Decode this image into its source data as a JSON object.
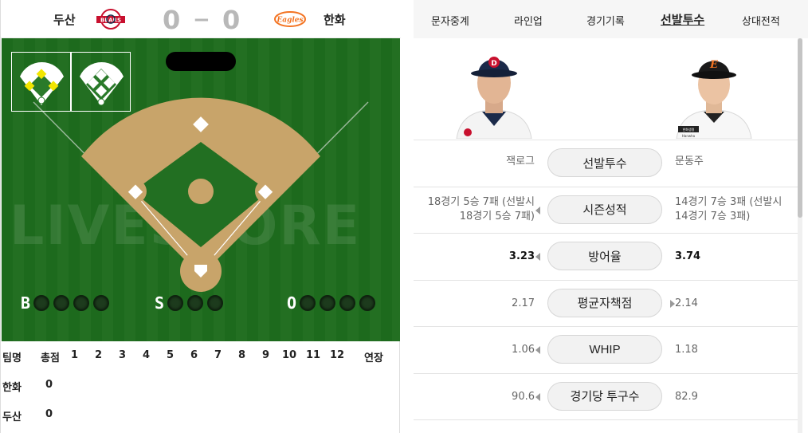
{
  "scoreboard": {
    "away_team": "두산",
    "home_team": "한화",
    "away_score": "0",
    "dash": "−",
    "home_score": "0",
    "away_logo_text": "BEARS",
    "home_logo_text": "Eagles"
  },
  "field": {
    "watermark": "LIVESCORE",
    "count_labels": {
      "ball": "B",
      "strike": "S",
      "out": "O"
    },
    "count_values": {
      "ball": 0,
      "strike": 0,
      "out": 0
    }
  },
  "innings": {
    "headers": [
      "팀명",
      "총점",
      "1",
      "2",
      "3",
      "4",
      "5",
      "6",
      "7",
      "8",
      "9",
      "10",
      "11",
      "12",
      "연장"
    ],
    "rows": [
      {
        "team": "한화",
        "total": "0"
      },
      {
        "team": "두산",
        "total": "0"
      }
    ]
  },
  "tabs": [
    {
      "label": "문자중계",
      "active": false
    },
    {
      "label": "라인업",
      "active": false
    },
    {
      "label": "경기기록",
      "active": false
    },
    {
      "label": "선발투수",
      "active": true
    },
    {
      "label": "상대전적",
      "active": false
    }
  ],
  "stats": [
    {
      "label": "선발투수",
      "left": "잭로그",
      "right": "문동주",
      "left_bold": false,
      "right_bold": false,
      "left_arrow": false,
      "right_arrow": false
    },
    {
      "label": "시즌성적",
      "left": "18경기 5승 7패 (선발시 18경기 5승 7패)",
      "left_l1": "18경기 5승 7패 (선발시",
      "left_l2": "18경기 5승 7패)",
      "right_l1": "14경기 7승 3패 (선발시",
      "right_l2": "14경기 7승 3패)",
      "left_arrow": true,
      "right_arrow": false
    },
    {
      "label": "방어율",
      "left": "3.23",
      "right": "3.74",
      "left_bold": true,
      "right_bold": true,
      "left_arrow": true,
      "right_arrow": false
    },
    {
      "label": "평균자책점",
      "left": "2.17",
      "right": "2.14",
      "left_bold": false,
      "right_bold": false,
      "left_arrow": false,
      "right_arrow": true
    },
    {
      "label": "WHIP",
      "left": "1.06",
      "right": "1.18",
      "left_bold": false,
      "right_bold": false,
      "left_arrow": true,
      "right_arrow": false
    },
    {
      "label": "경기당 투구수",
      "left": "90.6",
      "right": "82.9",
      "left_bold": false,
      "right_bold": false,
      "left_arrow": true,
      "right_arrow": false
    }
  ],
  "players": {
    "away_cap_letter": "D",
    "home_cap_letter": "E",
    "home_jersey_text": "한화생명",
    "home_jersey_sub": "Hanwha",
    "colors": {
      "away_cap": "#1b2a4a",
      "home_cap": "#1a1a1a",
      "home_logo": "#f37321",
      "away_logo": "#c8102e"
    }
  }
}
